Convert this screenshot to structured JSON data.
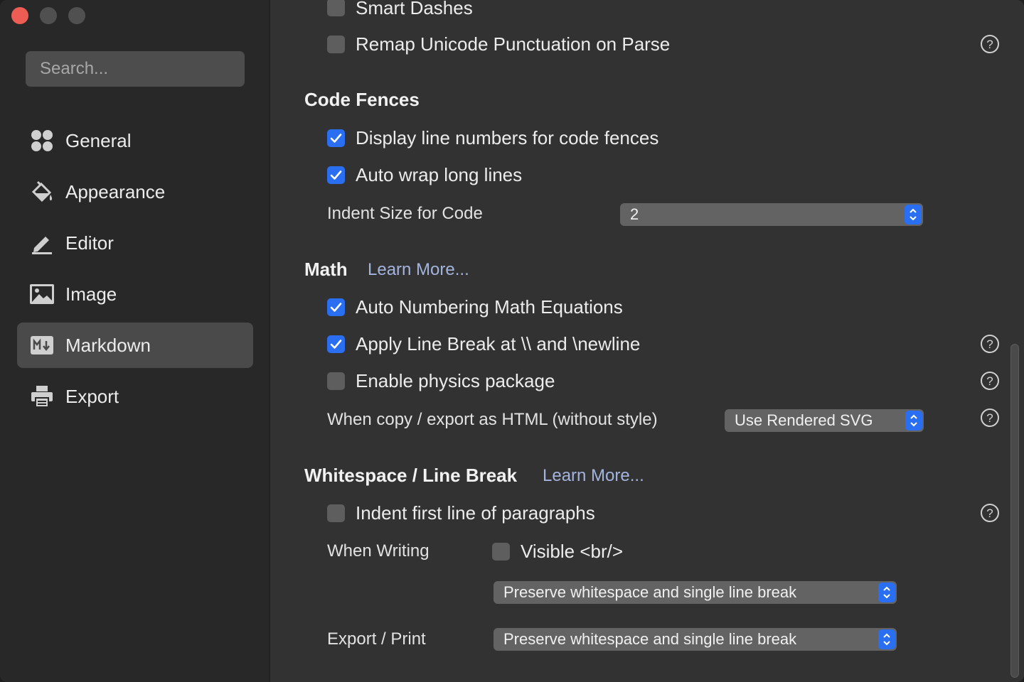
{
  "sidebar": {
    "search_placeholder": "Search...",
    "items": [
      {
        "label": "General",
        "icon": "grid-icon"
      },
      {
        "label": "Appearance",
        "icon": "paint-bucket-icon"
      },
      {
        "label": "Editor",
        "icon": "pencil-icon"
      },
      {
        "label": "Image",
        "icon": "image-icon"
      },
      {
        "label": "Markdown",
        "icon": "markdown-icon",
        "active": true
      },
      {
        "label": "Export",
        "icon": "printer-icon"
      }
    ]
  },
  "top_options": {
    "smart_dashes": {
      "label": "Smart Dashes",
      "checked": false
    },
    "remap_unicode": {
      "label": "Remap Unicode Punctuation on Parse",
      "checked": false
    }
  },
  "code_fences": {
    "title": "Code Fences",
    "display_line_numbers": {
      "label": "Display line numbers for code fences",
      "checked": true
    },
    "auto_wrap": {
      "label": "Auto wrap long lines",
      "checked": true
    },
    "indent_label": "Indent Size for Code",
    "indent_value": "2"
  },
  "math": {
    "title": "Math",
    "learn_more": "Learn More...",
    "auto_numbering": {
      "label": "Auto Numbering Math Equations",
      "checked": true
    },
    "apply_line_break": {
      "label": "Apply Line Break at \\\\ and \\newline",
      "checked": true
    },
    "physics": {
      "label": "Enable physics package",
      "checked": false
    },
    "copy_export_label": "When copy / export as HTML (without style)",
    "copy_export_value": "Use Rendered SVG"
  },
  "whitespace": {
    "title": "Whitespace / Line Break",
    "learn_more": "Learn More...",
    "indent_first": {
      "label": "Indent first line of paragraphs",
      "checked": false
    },
    "when_writing_label": "When Writing",
    "visible_br": {
      "label": "Visible <br/>",
      "checked": false
    },
    "when_writing_value": "Preserve whitespace and single line break",
    "export_print_label": "Export / Print",
    "export_print_value": "Preserve whitespace and single line break"
  },
  "colors": {
    "accent": "#2a6ef2",
    "close_button": "#ed5d53",
    "link": "#a3b4dd"
  }
}
